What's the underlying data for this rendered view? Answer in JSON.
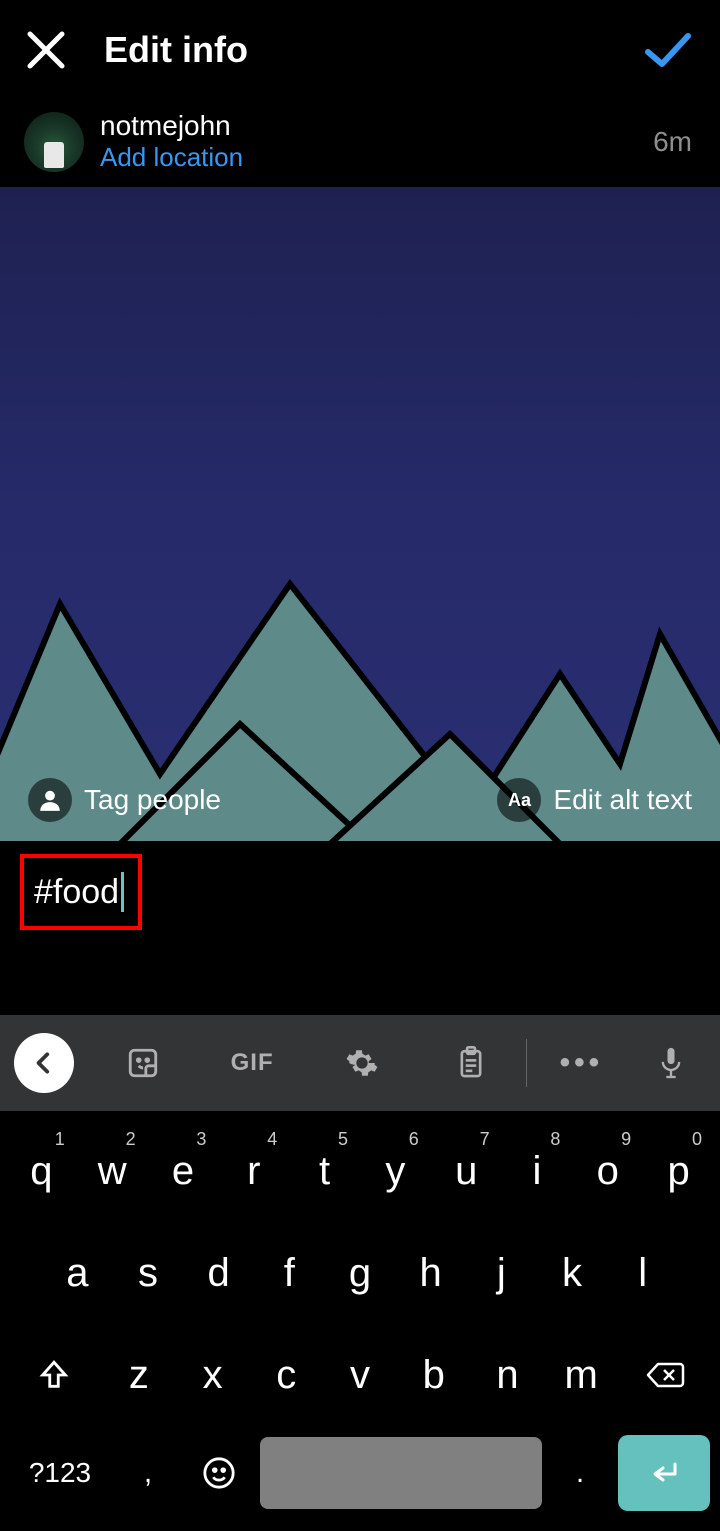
{
  "header": {
    "title": "Edit info"
  },
  "user": {
    "name": "notmejohn",
    "location_action": "Add location",
    "time": "6m"
  },
  "image_actions": {
    "tag_label": "Tag people",
    "alt_label": "Edit alt text",
    "alt_icon_text": "Aa"
  },
  "caption": {
    "text": "#food"
  },
  "toolbar": {
    "gif_label": "GIF"
  },
  "keyboard": {
    "row1": [
      {
        "k": "q",
        "n": "1"
      },
      {
        "k": "w",
        "n": "2"
      },
      {
        "k": "e",
        "n": "3"
      },
      {
        "k": "r",
        "n": "4"
      },
      {
        "k": "t",
        "n": "5"
      },
      {
        "k": "y",
        "n": "6"
      },
      {
        "k": "u",
        "n": "7"
      },
      {
        "k": "i",
        "n": "8"
      },
      {
        "k": "o",
        "n": "9"
      },
      {
        "k": "p",
        "n": "0"
      }
    ],
    "row2": [
      "a",
      "s",
      "d",
      "f",
      "g",
      "h",
      "j",
      "k",
      "l"
    ],
    "row3": [
      "z",
      "x",
      "c",
      "v",
      "b",
      "n",
      "m"
    ],
    "sym": "?123",
    "comma": ",",
    "dot": "."
  }
}
